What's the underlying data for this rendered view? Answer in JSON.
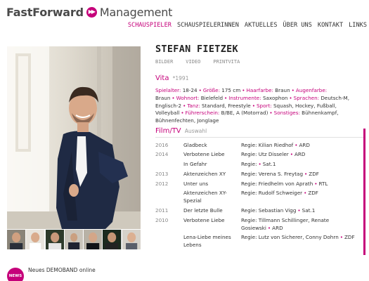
{
  "logo": {
    "part1": "FastForward",
    "icon": "fast-forward-icon",
    "part2": "Management"
  },
  "nav": [
    "SCHAUSPIELER",
    "SCHAUSPIELERINNEN",
    "AKTUELLES",
    "ÜBER UNS",
    "KONTAKT",
    "LINKS"
  ],
  "colors": {
    "accent": "#c5007a"
  },
  "profile": {
    "name": "STEFAN FIETZEK",
    "subnav": [
      "BILDER",
      "VIDEO",
      "PRINTVITA"
    ]
  },
  "vita": {
    "heading": "Vita",
    "born": "*1991",
    "fields": [
      {
        "k": "Spielalter:",
        "v": "18-24"
      },
      {
        "k": "Größe:",
        "v": "175 cm"
      },
      {
        "k": "Haarfarbe:",
        "v": "Braun"
      },
      {
        "k": "Augenfarbe:",
        "v": "Braun"
      },
      {
        "k": "Wohnort:",
        "v": "Bielefeld"
      },
      {
        "k": "Instrumente:",
        "v": "Saxophon"
      },
      {
        "k": "Sprachen:",
        "v": "Deutsch-M, Englisch-2"
      },
      {
        "k": "Tanz:",
        "v": "Standard, Freestyle"
      },
      {
        "k": "Sport:",
        "v": "Squash, Hockey, Fußball, Volleyball"
      },
      {
        "k": "Führerschein:",
        "v": "B/BE, A (Motorrad)"
      },
      {
        "k": "Sonstiges:",
        "v": "Bühnenkampf, Bühnenfechten, Jonglage"
      }
    ]
  },
  "film": {
    "heading": "Film/TV",
    "sub": "Auswahl",
    "rows": [
      {
        "year": "2016",
        "title": "Gladbeck",
        "regie": "Regie: Kilian Riedhof",
        "sender": "ARD"
      },
      {
        "year": "2014",
        "title": "Verbotene Liebe",
        "regie": "Regie: Utz Disseler",
        "sender": "ARD"
      },
      {
        "year": "",
        "title": "In Gefahr",
        "regie": "Regie:",
        "sender": "Sat.1"
      },
      {
        "year": "2013",
        "title": "Aktenzeichen XY",
        "regie": "Regie: Verena S. Freytag",
        "sender": "ZDF"
      },
      {
        "year": "2012",
        "title": "Unter uns",
        "regie": "Regie: Friedhelm von Aprath",
        "sender": "RTL"
      },
      {
        "year": "",
        "title": "Aktenzeichen XY-Spezial",
        "regie": "Regie: Rudolf Schweiger",
        "sender": "ZDF"
      },
      {
        "year": "2011",
        "title": "Der letzte Bulle",
        "regie": "Regie: Sebastian Vigg",
        "sender": "Sat.1"
      },
      {
        "year": "2010",
        "title": "Verbotene Liebe",
        "regie": "Regie: Tillmann Schillinger, Renate Gosiewski",
        "sender": "ARD"
      },
      {
        "year": "",
        "title": "Lena-Liebe meines Lebens",
        "regie": "Regie: Lutz von Sicherer, Conny Dohrn",
        "sender": "ZDF"
      }
    ]
  },
  "news": {
    "badge": "NEWS",
    "text": "Neues DEMOBAND online"
  }
}
